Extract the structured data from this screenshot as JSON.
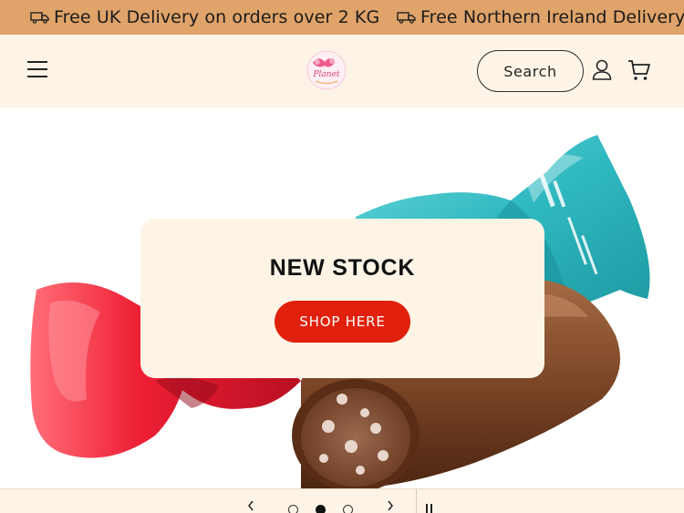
{
  "announcement": {
    "messages": [
      "Free UK Delivery on orders over 2 KG",
      "Free Northern Ireland Delivery o"
    ]
  },
  "header": {
    "search_label": "Search",
    "logo_text": "Planet"
  },
  "hero": {
    "title": "NEW STOCK",
    "button_label": "SHOP HERE"
  },
  "slider": {
    "slide_count": 3,
    "active_slide": 2
  },
  "colors": {
    "announcement_bg": "#e0a36a",
    "header_bg": "#fdf4e7",
    "card_bg": "#fdf4e6",
    "accent": "#e0200c"
  }
}
